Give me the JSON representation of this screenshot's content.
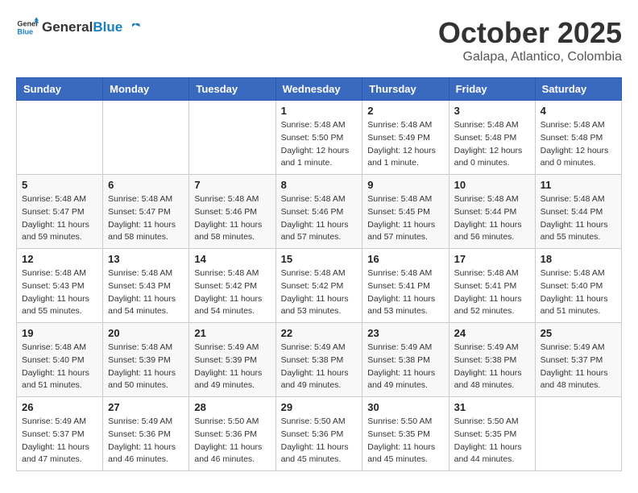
{
  "header": {
    "logo_general": "General",
    "logo_blue": "Blue",
    "month": "October 2025",
    "location": "Galapa, Atlantico, Colombia"
  },
  "days_of_week": [
    "Sunday",
    "Monday",
    "Tuesday",
    "Wednesday",
    "Thursday",
    "Friday",
    "Saturday"
  ],
  "weeks": [
    [
      {
        "day": "",
        "info": ""
      },
      {
        "day": "",
        "info": ""
      },
      {
        "day": "",
        "info": ""
      },
      {
        "day": "1",
        "info": "Sunrise: 5:48 AM\nSunset: 5:50 PM\nDaylight: 12 hours\nand 1 minute."
      },
      {
        "day": "2",
        "info": "Sunrise: 5:48 AM\nSunset: 5:49 PM\nDaylight: 12 hours\nand 1 minute."
      },
      {
        "day": "3",
        "info": "Sunrise: 5:48 AM\nSunset: 5:48 PM\nDaylight: 12 hours\nand 0 minutes."
      },
      {
        "day": "4",
        "info": "Sunrise: 5:48 AM\nSunset: 5:48 PM\nDaylight: 12 hours\nand 0 minutes."
      }
    ],
    [
      {
        "day": "5",
        "info": "Sunrise: 5:48 AM\nSunset: 5:47 PM\nDaylight: 11 hours\nand 59 minutes."
      },
      {
        "day": "6",
        "info": "Sunrise: 5:48 AM\nSunset: 5:47 PM\nDaylight: 11 hours\nand 58 minutes."
      },
      {
        "day": "7",
        "info": "Sunrise: 5:48 AM\nSunset: 5:46 PM\nDaylight: 11 hours\nand 58 minutes."
      },
      {
        "day": "8",
        "info": "Sunrise: 5:48 AM\nSunset: 5:46 PM\nDaylight: 11 hours\nand 57 minutes."
      },
      {
        "day": "9",
        "info": "Sunrise: 5:48 AM\nSunset: 5:45 PM\nDaylight: 11 hours\nand 57 minutes."
      },
      {
        "day": "10",
        "info": "Sunrise: 5:48 AM\nSunset: 5:44 PM\nDaylight: 11 hours\nand 56 minutes."
      },
      {
        "day": "11",
        "info": "Sunrise: 5:48 AM\nSunset: 5:44 PM\nDaylight: 11 hours\nand 55 minutes."
      }
    ],
    [
      {
        "day": "12",
        "info": "Sunrise: 5:48 AM\nSunset: 5:43 PM\nDaylight: 11 hours\nand 55 minutes."
      },
      {
        "day": "13",
        "info": "Sunrise: 5:48 AM\nSunset: 5:43 PM\nDaylight: 11 hours\nand 54 minutes."
      },
      {
        "day": "14",
        "info": "Sunrise: 5:48 AM\nSunset: 5:42 PM\nDaylight: 11 hours\nand 54 minutes."
      },
      {
        "day": "15",
        "info": "Sunrise: 5:48 AM\nSunset: 5:42 PM\nDaylight: 11 hours\nand 53 minutes."
      },
      {
        "day": "16",
        "info": "Sunrise: 5:48 AM\nSunset: 5:41 PM\nDaylight: 11 hours\nand 53 minutes."
      },
      {
        "day": "17",
        "info": "Sunrise: 5:48 AM\nSunset: 5:41 PM\nDaylight: 11 hours\nand 52 minutes."
      },
      {
        "day": "18",
        "info": "Sunrise: 5:48 AM\nSunset: 5:40 PM\nDaylight: 11 hours\nand 51 minutes."
      }
    ],
    [
      {
        "day": "19",
        "info": "Sunrise: 5:48 AM\nSunset: 5:40 PM\nDaylight: 11 hours\nand 51 minutes."
      },
      {
        "day": "20",
        "info": "Sunrise: 5:48 AM\nSunset: 5:39 PM\nDaylight: 11 hours\nand 50 minutes."
      },
      {
        "day": "21",
        "info": "Sunrise: 5:49 AM\nSunset: 5:39 PM\nDaylight: 11 hours\nand 49 minutes."
      },
      {
        "day": "22",
        "info": "Sunrise: 5:49 AM\nSunset: 5:38 PM\nDaylight: 11 hours\nand 49 minutes."
      },
      {
        "day": "23",
        "info": "Sunrise: 5:49 AM\nSunset: 5:38 PM\nDaylight: 11 hours\nand 49 minutes."
      },
      {
        "day": "24",
        "info": "Sunrise: 5:49 AM\nSunset: 5:38 PM\nDaylight: 11 hours\nand 48 minutes."
      },
      {
        "day": "25",
        "info": "Sunrise: 5:49 AM\nSunset: 5:37 PM\nDaylight: 11 hours\nand 48 minutes."
      }
    ],
    [
      {
        "day": "26",
        "info": "Sunrise: 5:49 AM\nSunset: 5:37 PM\nDaylight: 11 hours\nand 47 minutes."
      },
      {
        "day": "27",
        "info": "Sunrise: 5:49 AM\nSunset: 5:36 PM\nDaylight: 11 hours\nand 46 minutes."
      },
      {
        "day": "28",
        "info": "Sunrise: 5:50 AM\nSunset: 5:36 PM\nDaylight: 11 hours\nand 46 minutes."
      },
      {
        "day": "29",
        "info": "Sunrise: 5:50 AM\nSunset: 5:36 PM\nDaylight: 11 hours\nand 45 minutes."
      },
      {
        "day": "30",
        "info": "Sunrise: 5:50 AM\nSunset: 5:35 PM\nDaylight: 11 hours\nand 45 minutes."
      },
      {
        "day": "31",
        "info": "Sunrise: 5:50 AM\nSunset: 5:35 PM\nDaylight: 11 hours\nand 44 minutes."
      },
      {
        "day": "",
        "info": ""
      }
    ]
  ]
}
